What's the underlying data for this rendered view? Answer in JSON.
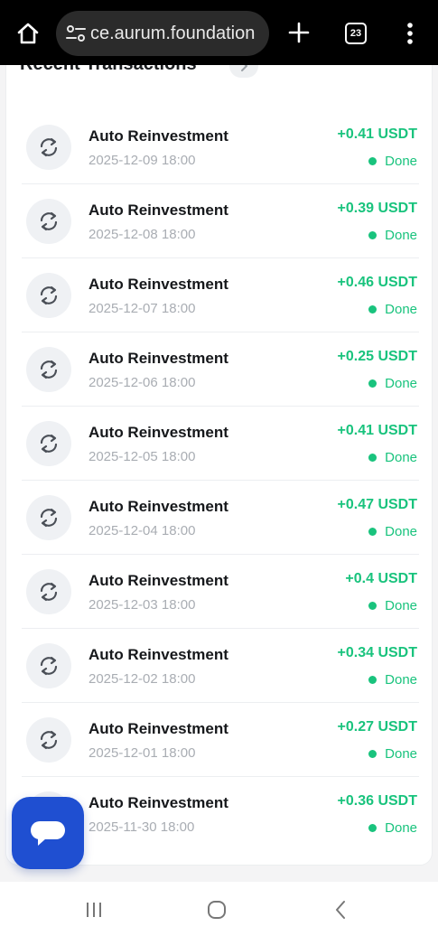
{
  "browser": {
    "url": "ce.aurum.foundation",
    "tab_count": "23"
  },
  "section": {
    "title": "Recent Transactions"
  },
  "transactions": [
    {
      "title": "Auto Reinvestment",
      "date": "2025-12-09 18:00",
      "amount": "+0.41 USDT",
      "status": "Done"
    },
    {
      "title": "Auto Reinvestment",
      "date": "2025-12-08 18:00",
      "amount": "+0.39 USDT",
      "status": "Done"
    },
    {
      "title": "Auto Reinvestment",
      "date": "2025-12-07 18:00",
      "amount": "+0.46 USDT",
      "status": "Done"
    },
    {
      "title": "Auto Reinvestment",
      "date": "2025-12-06 18:00",
      "amount": "+0.25 USDT",
      "status": "Done"
    },
    {
      "title": "Auto Reinvestment",
      "date": "2025-12-05 18:00",
      "amount": "+0.41 USDT",
      "status": "Done"
    },
    {
      "title": "Auto Reinvestment",
      "date": "2025-12-04 18:00",
      "amount": "+0.47 USDT",
      "status": "Done"
    },
    {
      "title": "Auto Reinvestment",
      "date": "2025-12-03 18:00",
      "amount": "+0.4 USDT",
      "status": "Done"
    },
    {
      "title": "Auto Reinvestment",
      "date": "2025-12-02 18:00",
      "amount": "+0.34 USDT",
      "status": "Done"
    },
    {
      "title": "Auto Reinvestment",
      "date": "2025-12-01 18:00",
      "amount": "+0.27 USDT",
      "status": "Done"
    },
    {
      "title": "Auto Reinvestment",
      "date": "2025-11-30 18:00",
      "amount": "+0.36 USDT",
      "status": "Done"
    }
  ],
  "icons": {
    "home": "home-icon",
    "site_settings": "tune-icon",
    "new_tab": "plus-icon",
    "tabs": "tab-count-icon",
    "menu": "more-vertical-icon",
    "transaction": "refresh-icon",
    "chat": "chat-bubble-icon",
    "nav_recents": "recents-icon",
    "nav_home": "home-circle-icon",
    "nav_back": "back-icon"
  },
  "colors": {
    "positive": "#19c37d",
    "chat_button": "#1f4fd1",
    "browser_bar": "#000000"
  }
}
